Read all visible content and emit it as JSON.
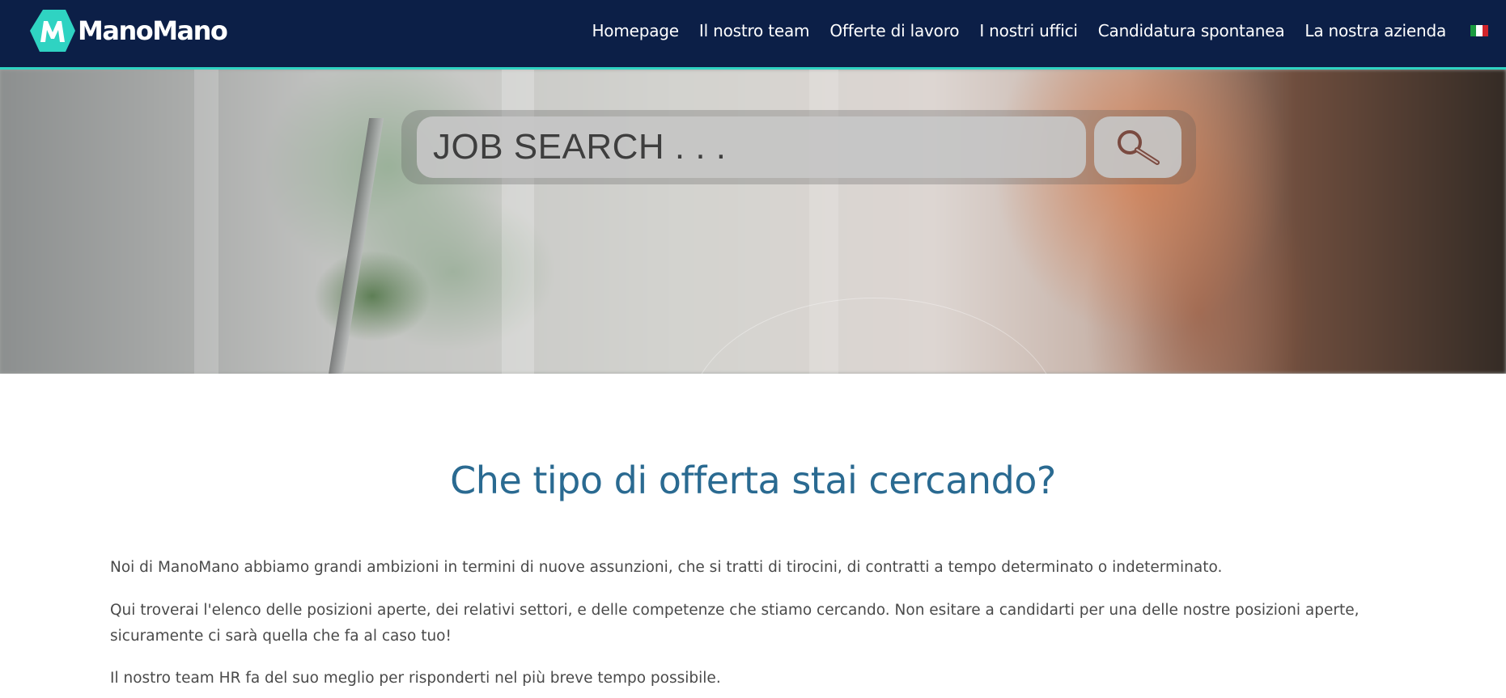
{
  "header": {
    "logo_text": "ManoMano",
    "nav": [
      "Homepage",
      "Il nostro team",
      "Offerte di lavoro",
      "I nostri uffici",
      "Candidatura spontanea",
      "La nostra azienda"
    ],
    "language_flag": "italian-flag-icon",
    "colors": {
      "background": "#0c1f47",
      "accent": "#2fd3c2"
    }
  },
  "hero": {
    "search_text": "JOB SEARCH . . .",
    "search_icon": "magnifier-icon"
  },
  "content": {
    "title": "Che tipo di offerta stai cercando?",
    "paragraphs": [
      "Noi di ManoMano abbiamo grandi ambizioni in termini di nuove assunzioni, che si tratti di tirocini, di contratti a tempo determinato o indeterminato.",
      "Qui troverai l'elenco delle posizioni aperte, dei relativi settori, e delle competenze che stiamo cercando. Non esitare a candidarti per una delle nostre posizioni aperte, sicuramente ci sarà quella che fa al caso tuo!",
      "Il nostro team HR fa del suo meglio per risponderti nel più breve tempo possibile."
    ],
    "title_color": "#2a6a91"
  }
}
